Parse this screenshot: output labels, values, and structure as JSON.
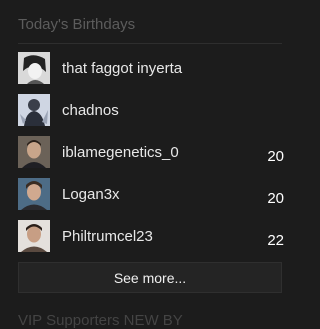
{
  "birthdays": {
    "title": "Today's Birthdays",
    "users": [
      {
        "username": "that faggot inyerta",
        "age": "",
        "avatar_icon": "avatar-anime-grayscale-icon"
      },
      {
        "username": "chadnos",
        "age": "",
        "avatar_icon": "avatar-figure-grayscale-icon"
      },
      {
        "username": "iblamegenetics_0",
        "age": "20",
        "avatar_icon": "avatar-man-photo-icon"
      },
      {
        "username": "Logan3x",
        "age": "20",
        "avatar_icon": "avatar-man-photo-icon"
      },
      {
        "username": "Philtrumcel23",
        "age": "22",
        "avatar_icon": "avatar-man-photo-icon"
      }
    ],
    "see_more_label": "See more..."
  },
  "next_section": {
    "title": "VIP Supporters NEW BY"
  },
  "colors": {
    "background": "#1c1c1c",
    "title": "#5c5c5c",
    "button": "#242424"
  }
}
